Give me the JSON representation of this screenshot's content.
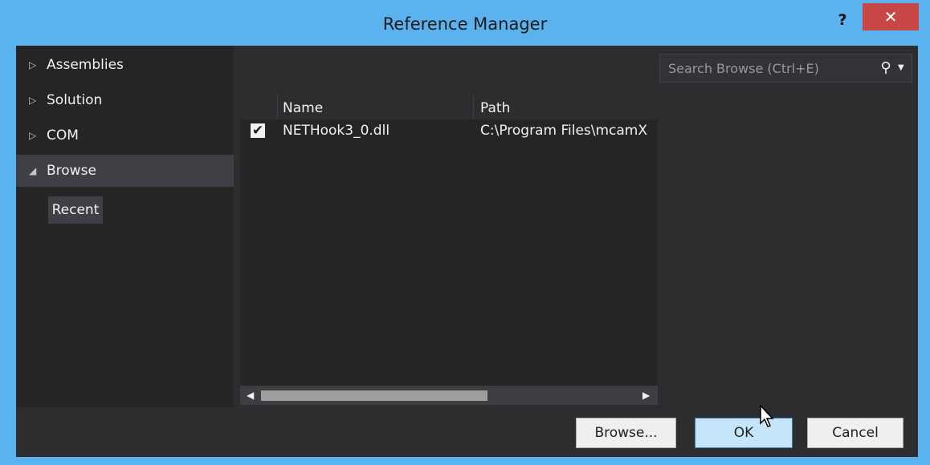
{
  "window": {
    "title": "Reference Manager",
    "help_label": "?",
    "close_label": "✕"
  },
  "nav": {
    "items": [
      {
        "label": "Assemblies",
        "glyph": "▷",
        "expanded": false
      },
      {
        "label": "Solution",
        "glyph": "▷",
        "expanded": false
      },
      {
        "label": "COM",
        "glyph": "▷",
        "expanded": false
      },
      {
        "label": "Browse",
        "glyph": "◢",
        "expanded": true,
        "selected": true
      }
    ],
    "sub_item": "Recent"
  },
  "search": {
    "placeholder": "Search Browse (Ctrl+E)",
    "icon": "⚲",
    "dropdown": "▼"
  },
  "list": {
    "columns": [
      "Name",
      "Path"
    ],
    "rows": [
      {
        "checked": true,
        "check_glyph": "✔",
        "name": "NETHook3_0.dll",
        "path": "C:\\Program Files\\mcamX"
      }
    ],
    "scroll_left": "◀",
    "scroll_right": "▶"
  },
  "footer": {
    "browse_label": "Browse...",
    "ok_label": "OK",
    "cancel_label": "Cancel"
  },
  "colors": {
    "window_frame": "#5ab2ee",
    "close_button": "#c84646",
    "panel": "#2d2d30",
    "nav_bg": "#252526",
    "selection": "#3f3f46",
    "ok_button": "#c5e6f9"
  }
}
